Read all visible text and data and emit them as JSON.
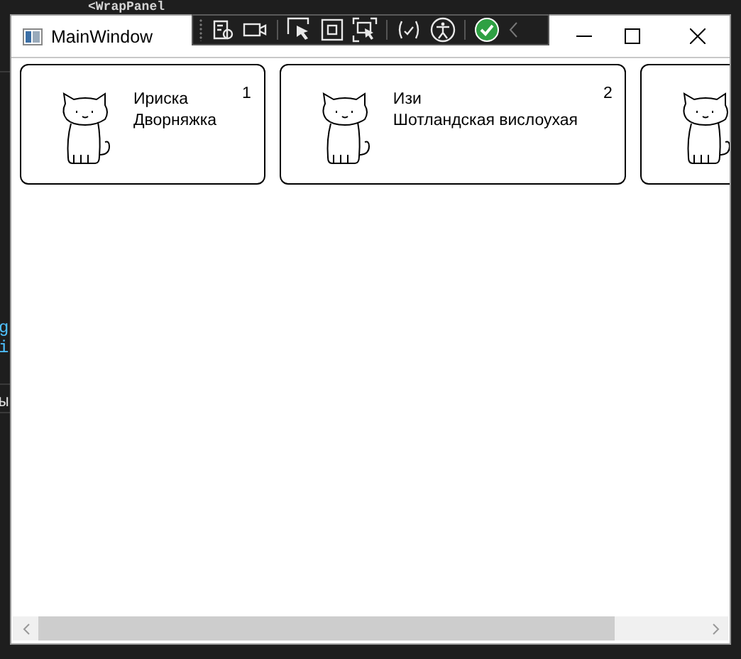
{
  "editor": {
    "code_line": "<WrapPanel",
    "fragments": [
      "g",
      "i",
      "ы"
    ]
  },
  "window": {
    "title": "MainWindow"
  },
  "cards": [
    {
      "kind": "full",
      "name": "Ириска",
      "breed": "Дворняжка",
      "number": "1"
    },
    {
      "kind": "full",
      "name": "Изи",
      "breed": "Шотландская вислоухая",
      "number": "2"
    },
    {
      "kind": "cut"
    }
  ]
}
